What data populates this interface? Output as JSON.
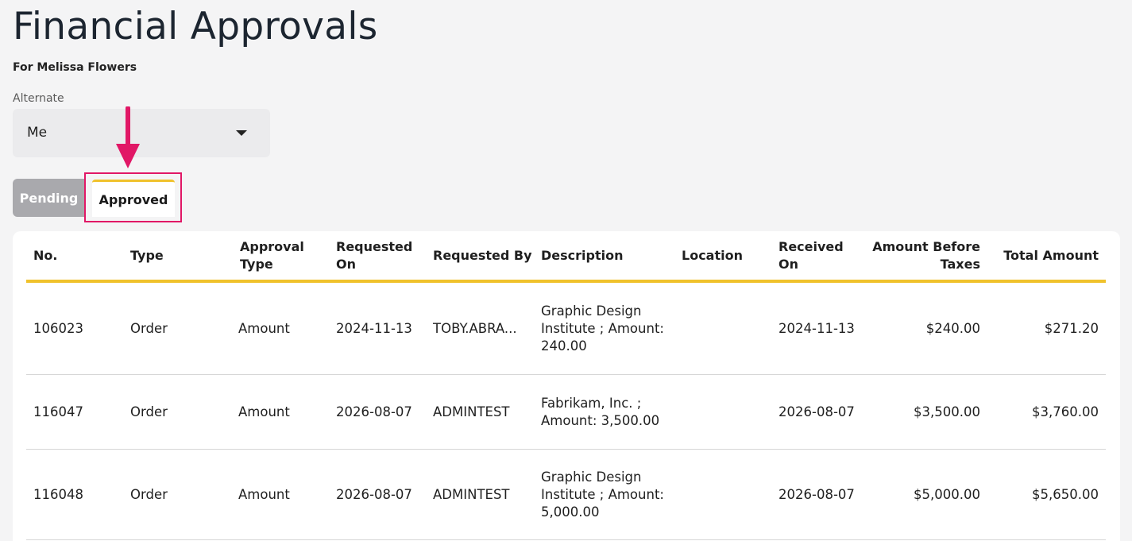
{
  "page": {
    "title": "Financial Approvals",
    "subtitle": "For Melissa Flowers"
  },
  "alternate": {
    "label": "Alternate",
    "selected": "Me"
  },
  "tabs": [
    {
      "label": "Pending",
      "active": false
    },
    {
      "label": "Approved",
      "active": true
    }
  ],
  "table": {
    "headers": {
      "no": "No.",
      "type": "Type",
      "approval_type": [
        "Approval",
        "Type"
      ],
      "requested_on": [
        "Requested",
        "On"
      ],
      "requested_by": "Requested By",
      "description": "Description",
      "location": "Location",
      "received_on": [
        "Received",
        "On"
      ],
      "amount_before_taxes": [
        "Amount Before",
        "Taxes"
      ],
      "total_amount": "Total Amount"
    },
    "rows": [
      {
        "no": "106023",
        "type": "Order",
        "approval_type": "Amount",
        "requested_on": "2024-11-13",
        "requested_by": "TOBY.ABRA...",
        "description": [
          "Graphic Design",
          "Institute ; Amount:",
          "240.00"
        ],
        "location": "",
        "received_on": "2024-11-13",
        "amount_before_taxes": "$240.00",
        "total_amount": "$271.20"
      },
      {
        "no": "116047",
        "type": "Order",
        "approval_type": "Amount",
        "requested_on": "2026-08-07",
        "requested_by": "ADMINTEST",
        "description": [
          "Fabrikam, Inc. ;",
          "Amount: 3,500.00"
        ],
        "location": "",
        "received_on": "2026-08-07",
        "amount_before_taxes": "$3,500.00",
        "total_amount": "$3,760.00"
      },
      {
        "no": "116048",
        "type": "Order",
        "approval_type": "Amount",
        "requested_on": "2026-08-07",
        "requested_by": "ADMINTEST",
        "description": [
          "Graphic Design",
          "Institute ; Amount:",
          "5,000.00"
        ],
        "location": "",
        "received_on": "2026-08-07",
        "amount_before_taxes": "$5,000.00",
        "total_amount": "$5,650.00"
      }
    ]
  },
  "colors": {
    "accent_yellow": "#f0c22c",
    "annotation_pink": "#e11766",
    "tab_inactive": "#a9a9ad"
  },
  "icons": {
    "dropdown": "caret-down-icon",
    "annotation": "arrow-down-icon"
  }
}
